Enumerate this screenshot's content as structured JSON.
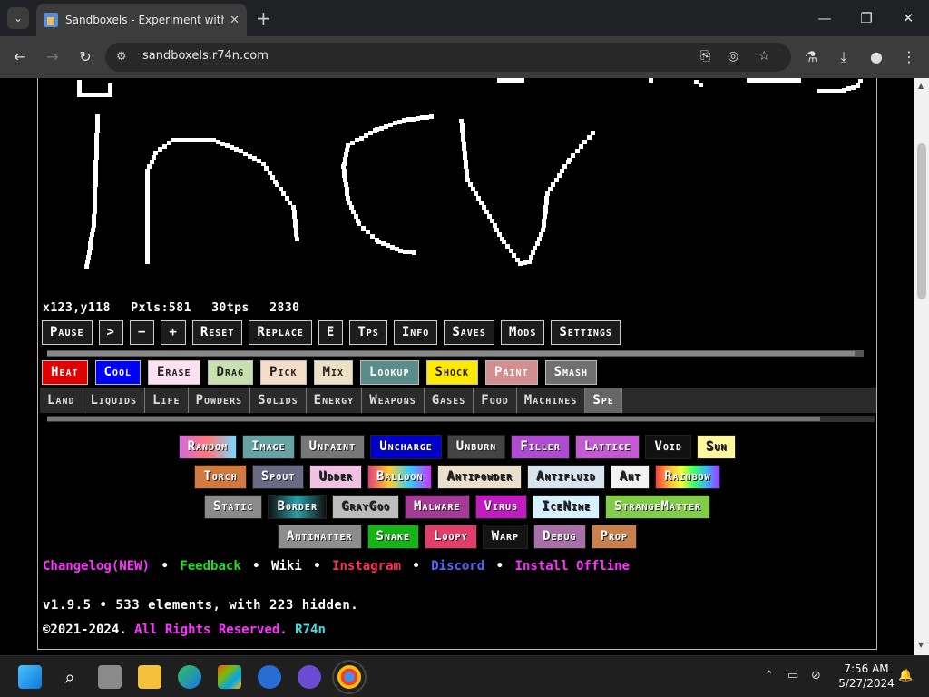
{
  "browser": {
    "tab_title": "Sandboxels - Experiment with F",
    "tab_close": "✕",
    "new_tab": "+",
    "url": "sandboxels.r74n.com",
    "minimize": "—",
    "restore": "❐",
    "close": "✕"
  },
  "stats": {
    "coords": "x123,y118",
    "pixels": "Pxls:581",
    "tps": "30tps",
    "ticks": "2830"
  },
  "controls": [
    "Pause",
    ">",
    "−",
    "+",
    "Reset",
    "Replace",
    "E",
    "Tps",
    "Info",
    "Saves",
    "Mods",
    "Settings"
  ],
  "tools": [
    {
      "label": "Heat",
      "bg": "#e00000",
      "fg": "#ffffff"
    },
    {
      "label": "Cool",
      "bg": "#0000ff",
      "fg": "#ffffff"
    },
    {
      "label": "Erase",
      "bg": "#fde1f2",
      "fg": "#222222"
    },
    {
      "label": "Drag",
      "bg": "#c8e0b0",
      "fg": "#222222"
    },
    {
      "label": "Pick",
      "bg": "#f4ddc8",
      "fg": "#222222"
    },
    {
      "label": "Mix",
      "bg": "#ece1c4",
      "fg": "#222222"
    },
    {
      "label": "Lookup",
      "bg": "#5b8c8c",
      "fg": "#ffffff"
    },
    {
      "label": "Shock",
      "bg": "#ffea00",
      "fg": "#222222"
    },
    {
      "label": "Paint",
      "bg": "#d38f8f",
      "fg": "#ffffff"
    },
    {
      "label": "Smash",
      "bg": "#707070",
      "fg": "#ffffff"
    }
  ],
  "categories": [
    "Land",
    "Liquids",
    "Life",
    "Powders",
    "Solids",
    "Energy",
    "Weapons",
    "Gases",
    "Food",
    "Machines",
    "Spe"
  ],
  "elements": [
    [
      {
        "label": "Random",
        "bg": "#d36bd8",
        "fg": "#ffffff"
      },
      {
        "label": "Image",
        "bg": "#66a3a3",
        "fg": "#ffffff"
      },
      {
        "label": "Unpaint",
        "bg": "#777777",
        "fg": "#ffffff"
      },
      {
        "label": "Uncharge",
        "bg": "#0000cc",
        "fg": "#ffffff"
      },
      {
        "label": "Unburn",
        "bg": "#444444",
        "fg": "#ffffff"
      },
      {
        "label": "Filler",
        "bg": "#ae4bd1",
        "fg": "#ffffff"
      },
      {
        "label": "Lattice",
        "bg": "#c35ad1",
        "fg": "#ffffff"
      },
      {
        "label": "Void",
        "bg": "#111111",
        "fg": "#ffffff"
      },
      {
        "label": "Sun",
        "bg": "#fff6a0",
        "fg": "#222222"
      }
    ],
    [
      {
        "label": "Torch",
        "bg": "#d1793e",
        "fg": "#ffffff"
      },
      {
        "label": "Spout",
        "bg": "#6a6a86",
        "fg": "#ffffff"
      },
      {
        "label": "Udder",
        "bg": "#f1c1e4",
        "fg": "#222222"
      },
      {
        "label": "Balloon",
        "bg": "#e0407a",
        "fg": "#ffffff"
      },
      {
        "label": "Antipowder",
        "bg": "#ebe0cc",
        "fg": "#222222"
      },
      {
        "label": "Antifluid",
        "bg": "#d8e4ee",
        "fg": "#222222"
      },
      {
        "label": "Ant",
        "bg": "#f2f2f2",
        "fg": "#222222"
      },
      {
        "label": "Rainbow",
        "bg": "#ff5060",
        "fg": "#ffffff"
      }
    ],
    [
      {
        "label": "Static",
        "bg": "#8a8a8a",
        "fg": "#ffffff"
      },
      {
        "label": "Border",
        "bg": "#2aa0a8",
        "fg": "#ffffff"
      },
      {
        "label": "GrayGoo",
        "bg": "#bdbdbd",
        "fg": "#222222"
      },
      {
        "label": "Malware",
        "bg": "#a53b96",
        "fg": "#ffffff"
      },
      {
        "label": "Virus",
        "bg": "#c21bc2",
        "fg": "#ffffff"
      },
      {
        "label": "IceNine",
        "bg": "#d6f0ff",
        "fg": "#222222"
      },
      {
        "label": "StrangeMatter",
        "bg": "#82cc4a",
        "fg": "#ffffff"
      }
    ],
    [
      {
        "label": "Antimatter",
        "bg": "#8d8d8d",
        "fg": "#ffffff"
      },
      {
        "label": "Snake",
        "bg": "#15b515",
        "fg": "#ffffff"
      },
      {
        "label": "Loopy",
        "bg": "#e23e6b",
        "fg": "#ffffff"
      },
      {
        "label": "Warp",
        "bg": "#141414",
        "fg": "#ffffff"
      },
      {
        "label": "Debug",
        "bg": "#a86fa8",
        "fg": "#ffffff"
      },
      {
        "label": "Prop",
        "bg": "#c9804c",
        "fg": "#ffffff"
      }
    ]
  ],
  "links": [
    {
      "label": "Changelog(NEW)",
      "color": "#ff33ff"
    },
    {
      "label": "Feedback",
      "color": "#22dd22"
    },
    {
      "label": "Wiki",
      "color": "#ffffff"
    },
    {
      "label": "Instagram",
      "color": "#ff3355"
    },
    {
      "label": "Discord",
      "color": "#5566ff"
    },
    {
      "label": "Install Offline",
      "color": "#ff33ff"
    }
  ],
  "link_separator": "•",
  "version": "v1.9.5 • 533 elements, with 223 hidden.",
  "copyright": {
    "prefix": "©2021-2024.",
    "rights": "All Rights Reserved.",
    "owner": "R74n",
    "rights_color": "#ff33ff",
    "owner_color": "#44dddd"
  },
  "taskbar": {
    "time": "7:56 AM",
    "date": "5/27/2024"
  }
}
